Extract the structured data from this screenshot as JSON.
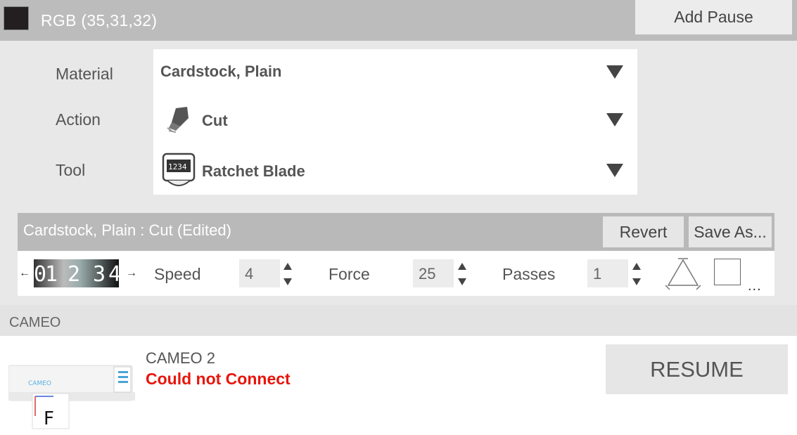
{
  "header": {
    "swatch_color": "#231f20",
    "color_label": "RGB (35,31,32)",
    "add_pause_label": "Add Pause"
  },
  "material_panel": {
    "material_label": "Material",
    "material_value": "Cardstock, Plain",
    "action_label": "Action",
    "action_value": "Cut",
    "action_icon": "cut-icon",
    "tool_label": "Tool",
    "tool_value": "Ratchet Blade",
    "tool_icon": "ratchet-blade-icon"
  },
  "settings": {
    "title": "Cardstock, Plain : Cut (Edited)",
    "revert_label": "Revert",
    "save_as_label": "Save As...",
    "blade_depth_digits": [
      "0",
      "1",
      "2",
      "3",
      "4"
    ],
    "speed_label": "Speed",
    "speed_value": "4",
    "force_label": "Force",
    "force_value": "25",
    "passes_label": "Passes",
    "passes_value": "1",
    "more_label": "..."
  },
  "device": {
    "section_label": "CAMEO",
    "name": "CAMEO 2",
    "status": "Could not Connect",
    "status_color": "#e8150c",
    "image_caption": "CAMEO",
    "image_letter": "F",
    "resume_label": "RESUME"
  }
}
